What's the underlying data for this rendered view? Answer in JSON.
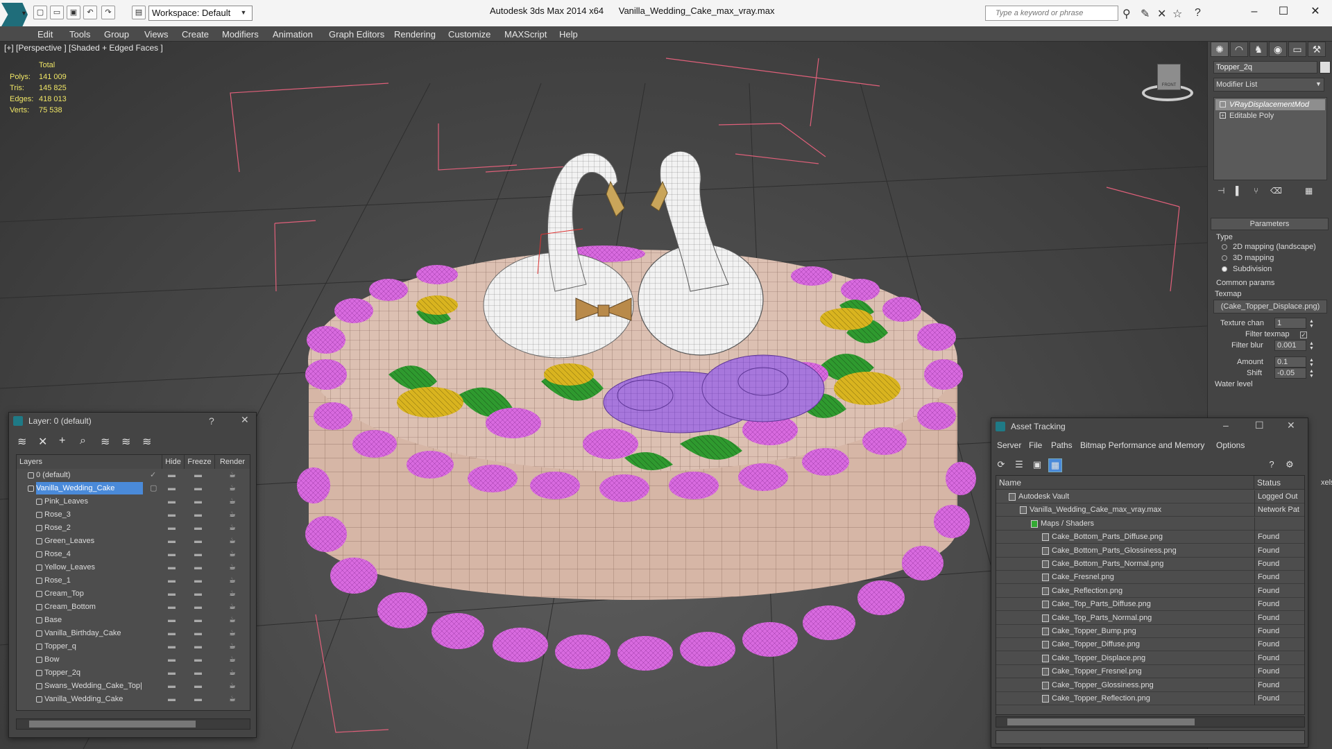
{
  "titlebar": {
    "workspace": "Workspace: Default",
    "app": "Autodesk 3ds Max  2014 x64",
    "file": "Vanilla_Wedding_Cake_max_vray.max",
    "search_placeholder": "Type a keyword or phrase"
  },
  "menu": [
    "Edit",
    "Tools",
    "Group",
    "Views",
    "Create",
    "Modifiers",
    "Animation",
    "Graph Editors",
    "Rendering",
    "Customize",
    "MAXScript",
    "Help"
  ],
  "viewport": {
    "label": "[+] [Perspective ] [Shaded + Edged Faces ]",
    "stats_header": "Total",
    "stats": [
      {
        "key": "Polys:",
        "value": "141 009"
      },
      {
        "key": "Tris:",
        "value": "145 825"
      },
      {
        "key": "Edges:",
        "value": "418 013"
      },
      {
        "key": "Verts:",
        "value": "75 538"
      }
    ],
    "viewcube_label": "FRONT"
  },
  "command_panel": {
    "object_name": "Topper_2q",
    "modifier_list": "Modifier List",
    "stack": [
      {
        "label": "VRayDisplacementMod",
        "selected": true
      },
      {
        "label": "Editable Poly",
        "selected": false
      }
    ],
    "rollout": "Parameters",
    "type_label": "Type",
    "types": [
      {
        "label": "2D mapping (landscape)",
        "on": false
      },
      {
        "label": "3D mapping",
        "on": false
      },
      {
        "label": "Subdivision",
        "on": true
      }
    ],
    "common_params": "Common params",
    "texmap_label": "Texmap",
    "texmap_value": "(Cake_Topper_Displace.png)",
    "texture_chan_label": "Texture chan",
    "texture_chan_value": "1",
    "filter_texmap_label": "Filter texmap",
    "filter_blur_label": "Filter blur",
    "filter_blur_value": "0.001",
    "amount_label": "Amount",
    "amount_value": "0.1",
    "shift_label": "Shift",
    "shift_value": "-0.05",
    "water_level_label": "Water level",
    "partial_label": "xels"
  },
  "layer_window": {
    "title": "Layer: 0 (default)",
    "help": "?",
    "columns": [
      "Layers",
      "Hide",
      "Freeze",
      "Render"
    ],
    "rows": [
      {
        "name": "0 (default)",
        "level": 0,
        "selected": false
      },
      {
        "name": "Vanilla_Wedding_Cake",
        "level": 0,
        "selected": true
      },
      {
        "name": "Pink_Leaves",
        "level": 1,
        "selected": false
      },
      {
        "name": "Rose_3",
        "level": 1,
        "selected": false
      },
      {
        "name": "Rose_2",
        "level": 1,
        "selected": false
      },
      {
        "name": "Green_Leaves",
        "level": 1,
        "selected": false
      },
      {
        "name": "Rose_4",
        "level": 1,
        "selected": false
      },
      {
        "name": "Yellow_Leaves",
        "level": 1,
        "selected": false
      },
      {
        "name": "Rose_1",
        "level": 1,
        "selected": false
      },
      {
        "name": "Cream_Top",
        "level": 1,
        "selected": false
      },
      {
        "name": "Cream_Bottom",
        "level": 1,
        "selected": false
      },
      {
        "name": "Base",
        "level": 1,
        "selected": false
      },
      {
        "name": "Vanilla_Birthday_Cake",
        "level": 1,
        "selected": false
      },
      {
        "name": "Topper_q",
        "level": 1,
        "selected": false
      },
      {
        "name": "Bow",
        "level": 1,
        "selected": false
      },
      {
        "name": "Topper_2q",
        "level": 1,
        "selected": false
      },
      {
        "name": "Swans_Wedding_Cake_Top|",
        "level": 1,
        "selected": false
      },
      {
        "name": "Vanilla_Wedding_Cake",
        "level": 1,
        "selected": false
      }
    ]
  },
  "asset_window": {
    "title": "Asset Tracking",
    "menu": [
      "Server",
      "File",
      "Paths",
      "Bitmap Performance and Memory",
      "Options"
    ],
    "columns": [
      "Name",
      "Status"
    ],
    "rows": [
      {
        "name": "Autodesk Vault",
        "status": "Logged Out",
        "level": 0
      },
      {
        "name": "Vanilla_Wedding_Cake_max_vray.max",
        "status": "Network Pat",
        "level": 1
      },
      {
        "name": "Maps / Shaders",
        "status": "",
        "level": 2
      },
      {
        "name": "Cake_Bottom_Parts_Diffuse.png",
        "status": "Found",
        "level": 3
      },
      {
        "name": "Cake_Bottom_Parts_Glossiness.png",
        "status": "Found",
        "level": 3
      },
      {
        "name": "Cake_Bottom_Parts_Normal.png",
        "status": "Found",
        "level": 3
      },
      {
        "name": "Cake_Fresnel.png",
        "status": "Found",
        "level": 3
      },
      {
        "name": "Cake_Reflection.png",
        "status": "Found",
        "level": 3
      },
      {
        "name": "Cake_Top_Parts_Diffuse.png",
        "status": "Found",
        "level": 3
      },
      {
        "name": "Cake_Top_Parts_Normal.png",
        "status": "Found",
        "level": 3
      },
      {
        "name": "Cake_Topper_Bump.png",
        "status": "Found",
        "level": 3
      },
      {
        "name": "Cake_Topper_Diffuse.png",
        "status": "Found",
        "level": 3
      },
      {
        "name": "Cake_Topper_Displace.png",
        "status": "Found",
        "level": 3
      },
      {
        "name": "Cake_Topper_Fresnel.png",
        "status": "Found",
        "level": 3
      },
      {
        "name": "Cake_Topper_Glossiness.png",
        "status": "Found",
        "level": 3
      },
      {
        "name": "Cake_Topper_Reflection.png",
        "status": "Found",
        "level": 3
      }
    ]
  },
  "colors": {
    "frosting": "#d96ee0",
    "cake": "#d7b8a8",
    "leaf": "#2f9a2f",
    "yellow_leaf": "#d9b41f",
    "rose": "#b27fe0",
    "selection": "#4a8ad9",
    "stats": "#f1e766"
  }
}
